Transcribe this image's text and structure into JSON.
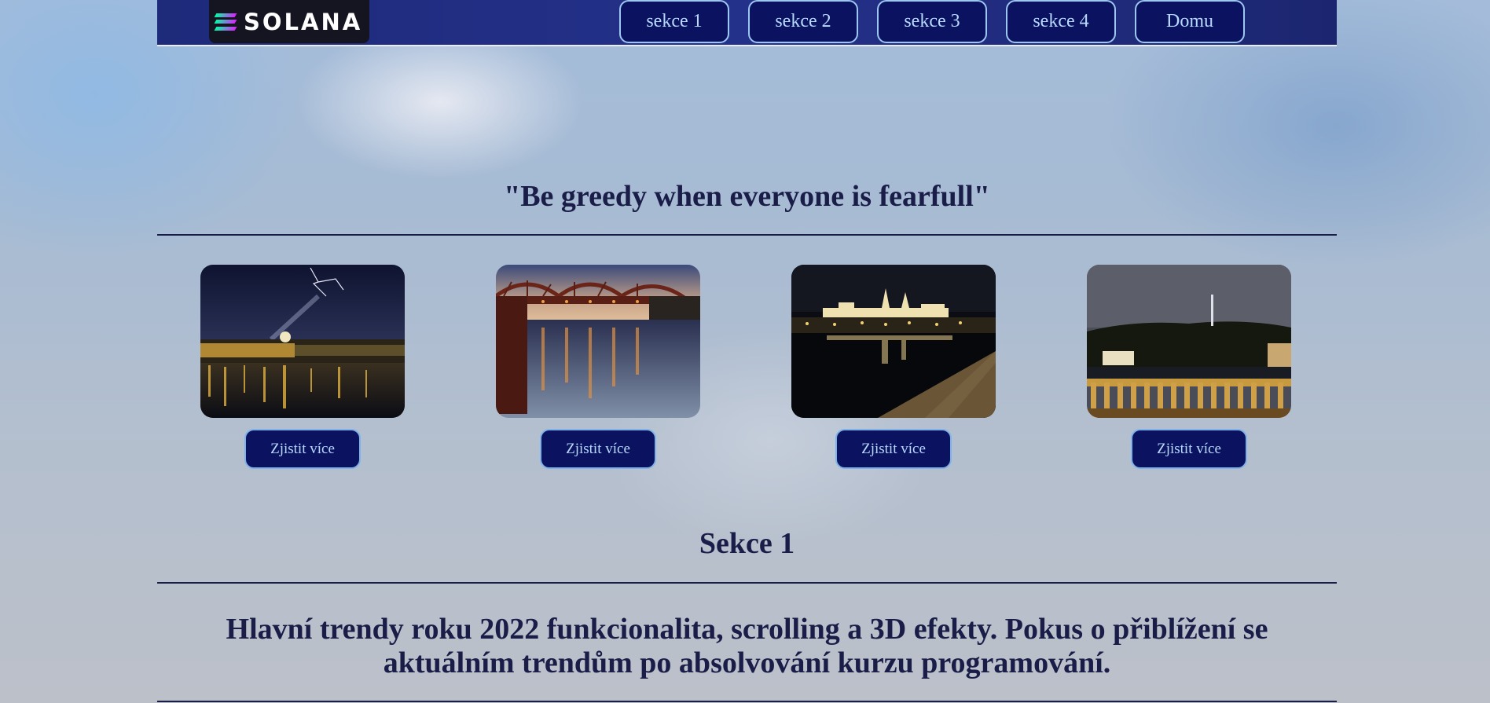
{
  "header": {
    "logo_text": "SOLANA",
    "nav": [
      "sekce 1",
      "sekce 2",
      "sekce 3",
      "sekce 4",
      "Domu"
    ]
  },
  "quote": "\"Be greedy when everyone is fearfull\"",
  "gallery": {
    "button_label": "Zjistit více",
    "items": [
      {
        "icon": "night-river-lightning-photo"
      },
      {
        "icon": "railway-bridge-dusk-photo"
      },
      {
        "icon": "prague-castle-night-photo"
      },
      {
        "icon": "riverside-hill-night-photo"
      }
    ]
  },
  "section": {
    "title": "Sekce 1",
    "text": "Hlavní trendy roku 2022 funkcionalita, scrolling a 3D efekty. Pokus o přiblížení se aktuálním trendům po absolvování kurzu programování."
  },
  "colors": {
    "nav_bg": "#24318a",
    "button_bg": "#0b1360",
    "button_text": "#b8daff",
    "heading": "#1a1d48"
  }
}
